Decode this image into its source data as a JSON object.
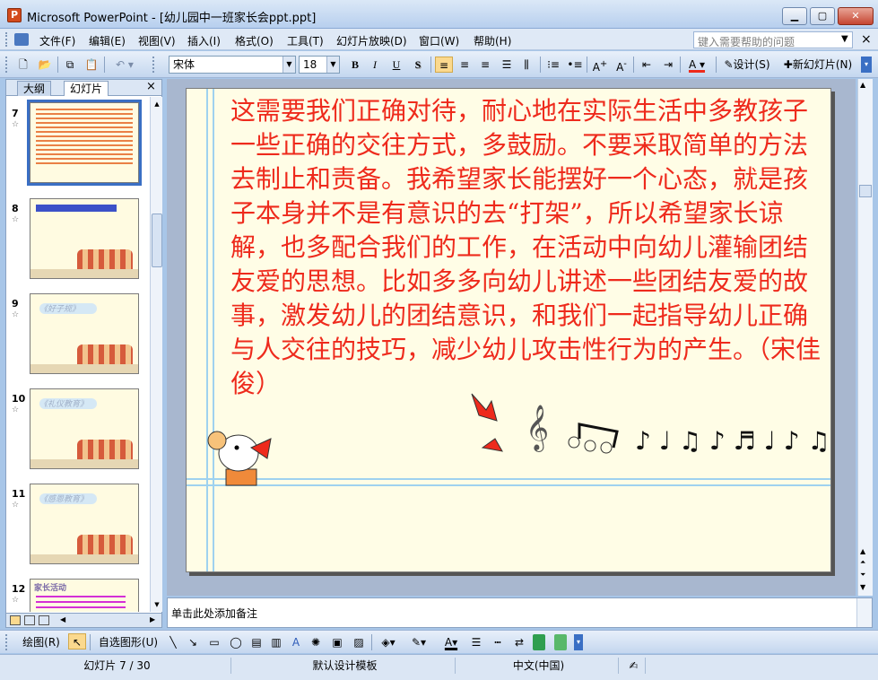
{
  "window": {
    "app_icon_letter": "P",
    "title": "Microsoft PowerPoint - [幼儿园中一班家长会ppt.ppt]"
  },
  "menu": {
    "items": [
      "文件(F)",
      "编辑(E)",
      "视图(V)",
      "插入(I)",
      "格式(O)",
      "工具(T)",
      "幻灯片放映(D)",
      "窗口(W)",
      "帮助(H)"
    ],
    "help_placeholder": "键入需要帮助的问题"
  },
  "toolbar": {
    "font_name": "宋体",
    "font_size": "18",
    "bold": "B",
    "italic": "I",
    "underline": "U",
    "shadow": "S",
    "design_label": "设计(S)",
    "new_slide_label": "新幻灯片(N)",
    "text_color": "#ee2a1c"
  },
  "left_panel": {
    "tab_outline": "大纲",
    "tab_slides": "幻灯片",
    "thumbnails": [
      {
        "number": "7",
        "selected": true,
        "style": "text"
      },
      {
        "number": "8",
        "selected": false,
        "style": "header"
      },
      {
        "number": "9",
        "selected": false,
        "style": "title",
        "title": "《好子规》"
      },
      {
        "number": "10",
        "selected": false,
        "style": "title",
        "title": "《礼仪教育》"
      },
      {
        "number": "11",
        "selected": false,
        "style": "title",
        "title": "《感恩教育》"
      },
      {
        "number": "12",
        "selected": false,
        "style": "pink",
        "title": "家长活动"
      }
    ]
  },
  "slide": {
    "body_text": "这需要我们正确对待，耐心地在实际生活中多教孩子一些正确的交往方式，多鼓励。不要采取简单的方法去制止和责备。我希望家长能摆好一个心态，就是孩子本身并不是有意识的去“打架”，所以希望家长谅解，也多配合我们的工作，在活动中向幼儿灌输团结友爱的思想。比如多多向幼儿讲述一些团结友爱的故事，激发幼儿的团结意识，和我们一起指导幼儿正确与人交往的技巧，减少幼儿攻击性行为的产生。（宋佳俊）",
    "background_color": "#fffde6",
    "line_color": "#9fd2ef"
  },
  "notes": {
    "placeholder": "单击此处添加备注"
  },
  "drawbar": {
    "draw_label": "绘图(R)",
    "autoshape_label": "自选图形(U)"
  },
  "status": {
    "slide_pos": "幻灯片 7 / 30",
    "template": "默认设计模板",
    "language": "中文(中国)"
  }
}
